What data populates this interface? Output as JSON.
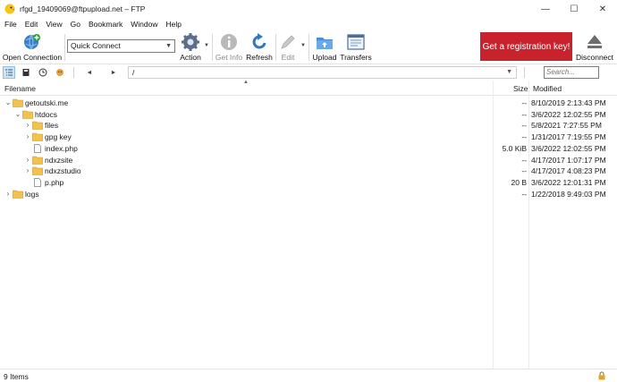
{
  "window": {
    "title": "rfgd_19409069@ftpupload.net – FTP",
    "minimize": "—",
    "maximize": "☐",
    "close": "✕"
  },
  "menu": [
    "File",
    "Edit",
    "View",
    "Go",
    "Bookmark",
    "Window",
    "Help"
  ],
  "toolbar": {
    "open_connection": "Open Connection",
    "quick_connect": "Quick Connect",
    "action": "Action",
    "get_info": "Get Info",
    "refresh": "Refresh",
    "edit": "Edit",
    "upload": "Upload",
    "transfers": "Transfers",
    "registration": "Get a registration key!",
    "disconnect": "Disconnect"
  },
  "pathbar": {
    "back": "◄",
    "forward": "►",
    "path": "/",
    "search_placeholder": "Search..."
  },
  "list": {
    "headers": {
      "filename": "Filename",
      "size": "Size",
      "modified": "Modified"
    },
    "rows": [
      {
        "name": "getoutski.me",
        "size": "--",
        "modified": "8/10/2019 2:13:43 PM",
        "type": "folder",
        "expander": "⌄"
      },
      {
        "name": "htdocs",
        "size": "--",
        "modified": "3/6/2022 12:02:55 PM",
        "type": "folder",
        "expander": "⌄"
      },
      {
        "name": "files",
        "size": "--",
        "modified": "5/8/2021 7:27:55 PM",
        "type": "folder",
        "expander": "›"
      },
      {
        "name": "gpg key",
        "size": "--",
        "modified": "1/31/2017 7:19:55 PM",
        "type": "folder",
        "expander": "›"
      },
      {
        "name": "index.php",
        "size": "5.0 KiB",
        "modified": "3/6/2022 12:02:55 PM",
        "type": "file",
        "expander": ""
      },
      {
        "name": "ndxzsite",
        "size": "--",
        "modified": "4/17/2017 1:07:17 PM",
        "type": "folder",
        "expander": "›"
      },
      {
        "name": "ndxzstudio",
        "size": "--",
        "modified": "4/17/2017 4:08:23 PM",
        "type": "folder",
        "expander": "›"
      },
      {
        "name": "p.php",
        "size": "20 B",
        "modified": "3/6/2022 12:01:31 PM",
        "type": "file",
        "expander": ""
      },
      {
        "name": "logs",
        "size": "--",
        "modified": "1/22/2018 9:49:03 PM",
        "type": "folder",
        "expander": "›"
      }
    ]
  },
  "status": {
    "items": "9 Items"
  },
  "colors": {
    "accent": "#c8232c",
    "folder": "#f2c14e",
    "selection": "#cde4f7"
  }
}
